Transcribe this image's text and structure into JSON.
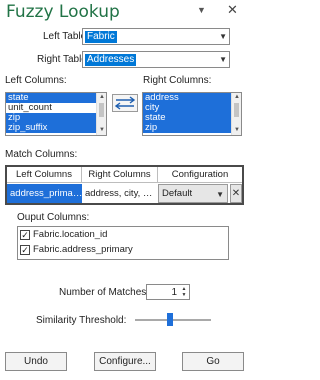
{
  "pane": {
    "title": "Fuzzy Lookup",
    "dropdown_glyph": "▼",
    "close_glyph": "✕"
  },
  "left_table": {
    "label": "Left Table:",
    "value": "Fabric"
  },
  "right_table": {
    "label": "Right Table:",
    "value": "Addresses"
  },
  "left_columns": {
    "label": "Left Columns:",
    "items": [
      {
        "text": "state",
        "selected": true
      },
      {
        "text": "unit_count",
        "selected": false
      },
      {
        "text": "zip",
        "selected": true
      },
      {
        "text": "zip_suffix",
        "selected": true
      }
    ]
  },
  "right_columns": {
    "label": "Right Columns:",
    "items": [
      {
        "text": "address",
        "selected": true
      },
      {
        "text": "city",
        "selected": true
      },
      {
        "text": "state",
        "selected": true
      },
      {
        "text": "zip",
        "selected": true
      }
    ]
  },
  "match_columns": {
    "label": "Match Columns:",
    "headers": [
      "Left Columns",
      "Right Columns",
      "Configuration"
    ],
    "row": {
      "left": "address_prima…",
      "right": "address, city, …",
      "configuration": "Default",
      "delete_glyph": "✕"
    }
  },
  "output_columns": {
    "label": "Ouput Columns:",
    "items": [
      {
        "text": "Fabric.location_id",
        "checked": true
      },
      {
        "text": "Fabric.address_primary",
        "checked": true
      }
    ]
  },
  "number_of_matches": {
    "label": "Number of Matches:",
    "value": "1"
  },
  "similarity_threshold": {
    "label": "Similarity Threshold:",
    "level": 0.46
  },
  "buttons": {
    "undo": "Undo",
    "configure": "Configure...",
    "go": "Go"
  },
  "colors": {
    "accent": "#217346",
    "selection": "#1e6fd9"
  }
}
